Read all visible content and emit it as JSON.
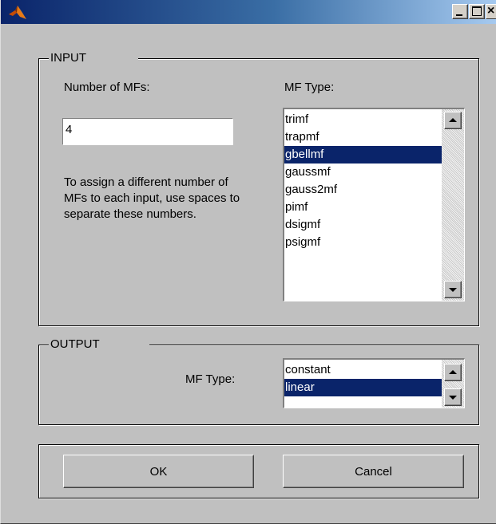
{
  "titlebar": {
    "icon": "matlab-logo-icon",
    "buttons": {
      "minimize": "minimize-icon",
      "maximize": "maximize-icon",
      "close": "×"
    }
  },
  "input": {
    "legend": "INPUT",
    "num_mfs_label": "Number of MFs:",
    "num_mfs_value": "4",
    "mf_type_label": "MF Type:",
    "help_text": "To assign a different number of MFs to each input, use spaces to separate these numbers.",
    "mf_types": [
      "trimf",
      "trapmf",
      "gbellmf",
      "gaussmf",
      "gauss2mf",
      "pimf",
      "dsigmf",
      "psigmf"
    ],
    "selected": "gbellmf"
  },
  "output": {
    "legend": "OUTPUT",
    "mf_type_label": "MF Type:",
    "mf_types": [
      "constant",
      "linear"
    ],
    "selected": "linear"
  },
  "buttons": {
    "ok": "OK",
    "cancel": "Cancel"
  },
  "colors": {
    "face": "#c0c0c0",
    "selection": "#0a246a",
    "title_start": "#0a246a",
    "title_end": "#a6caf0"
  }
}
